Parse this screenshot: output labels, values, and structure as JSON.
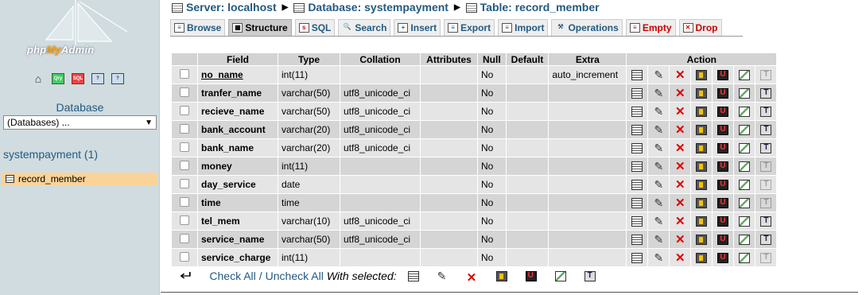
{
  "nav": {
    "logo_part1": "php",
    "logo_part2": "My",
    "logo_part3": "Admin",
    "icons": [
      "home-icon",
      "query-window-icon",
      "sql-icon",
      "docs-icon",
      "help-icon"
    ],
    "db_label": "Database",
    "db_select_value": "(Databases) ...",
    "db_name": "systempayment (1)",
    "table_item": "record_member"
  },
  "breadcrumb": {
    "server": "Server: localhost",
    "database": "Database: systempayment",
    "table": "Table: record_member"
  },
  "tabs": [
    {
      "label": "Browse",
      "icon": "browse-icon"
    },
    {
      "label": "Structure",
      "icon": "structure-icon"
    },
    {
      "label": "SQL",
      "icon": "sql-icon"
    },
    {
      "label": "Search",
      "icon": "search-icon"
    },
    {
      "label": "Insert",
      "icon": "insert-icon"
    },
    {
      "label": "Export",
      "icon": "export-icon"
    },
    {
      "label": "Import",
      "icon": "import-icon"
    },
    {
      "label": "Operations",
      "icon": "operations-icon"
    },
    {
      "label": "Empty",
      "icon": "empty-icon"
    },
    {
      "label": "Drop",
      "icon": "drop-icon"
    }
  ],
  "table": {
    "headers": {
      "field": "Field",
      "type": "Type",
      "collation": "Collation",
      "attributes": "Attributes",
      "null": "Null",
      "default": "Default",
      "extra": "Extra",
      "action": "Action"
    },
    "rows": [
      {
        "field": "no_name",
        "type": "int(11)",
        "collation": "",
        "null": "No",
        "extra": "auto_increment"
      },
      {
        "field": "tranfer_name",
        "type": "varchar(50)",
        "collation": "utf8_unicode_ci",
        "null": "No",
        "extra": ""
      },
      {
        "field": "recieve_name",
        "type": "varchar(50)",
        "collation": "utf8_unicode_ci",
        "null": "No",
        "extra": ""
      },
      {
        "field": "bank_account",
        "type": "varchar(20)",
        "collation": "utf8_unicode_ci",
        "null": "No",
        "extra": ""
      },
      {
        "field": "bank_name",
        "type": "varchar(20)",
        "collation": "utf8_unicode_ci",
        "null": "No",
        "extra": ""
      },
      {
        "field": "money",
        "type": "int(11)",
        "collation": "",
        "null": "No",
        "extra": ""
      },
      {
        "field": "day_service",
        "type": "date",
        "collation": "",
        "null": "No",
        "extra": ""
      },
      {
        "field": "time",
        "type": "time",
        "collation": "",
        "null": "No",
        "extra": ""
      },
      {
        "field": "tel_mem",
        "type": "varchar(10)",
        "collation": "utf8_unicode_ci",
        "null": "No",
        "extra": ""
      },
      {
        "field": "service_name",
        "type": "varchar(50)",
        "collation": "utf8_unicode_ci",
        "null": "No",
        "extra": ""
      },
      {
        "field": "service_charge",
        "type": "int(11)",
        "collation": "",
        "null": "No",
        "extra": ""
      }
    ]
  },
  "footer": {
    "check_all": "Check All",
    "separator": "/",
    "uncheck_all": "Uncheck All",
    "with_selected": "With selected:"
  }
}
